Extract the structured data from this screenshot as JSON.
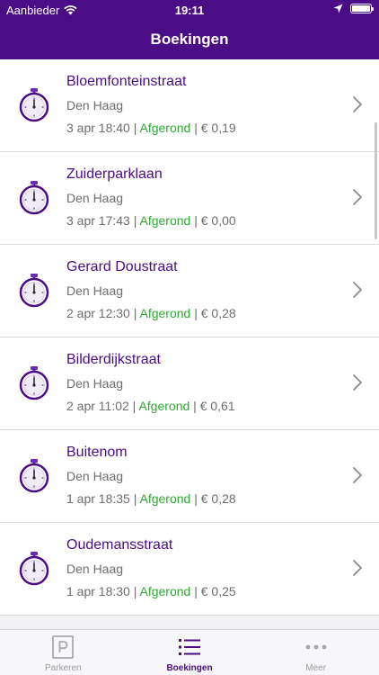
{
  "statusbar": {
    "carrier": "Aanbieder",
    "time": "19:11"
  },
  "navbar": {
    "title": "Boekingen"
  },
  "bookings": [
    {
      "street": "Bloemfonteinstraat",
      "city": "Den Haag",
      "datetime": "3 apr 18:40",
      "status": "Afgerond",
      "price": "€ 0,19"
    },
    {
      "street": "Zuiderparklaan",
      "city": "Den Haag",
      "datetime": "3 apr 17:43",
      "status": "Afgerond",
      "price": "€ 0,00"
    },
    {
      "street": "Gerard Doustraat",
      "city": "Den Haag",
      "datetime": "2 apr 12:30",
      "status": "Afgerond",
      "price": "€ 0,28"
    },
    {
      "street": "Bilderdijkstraat",
      "city": "Den Haag",
      "datetime": "2 apr 11:02",
      "status": "Afgerond",
      "price": "€ 0,61"
    },
    {
      "street": "Buitenom",
      "city": "Den Haag",
      "datetime": "1 apr 18:35",
      "status": "Afgerond",
      "price": "€ 0,28"
    },
    {
      "street": "Oudemansstraat",
      "city": "Den Haag",
      "datetime": "1 apr 18:30",
      "status": "Afgerond",
      "price": "€ 0,25"
    }
  ],
  "tabs": [
    {
      "label": "Parkeren",
      "icon": "parking-icon",
      "active": false
    },
    {
      "label": "Boekingen",
      "icon": "list-icon",
      "active": true
    },
    {
      "label": "Meer",
      "icon": "more-icon",
      "active": false
    }
  ],
  "colors": {
    "brand": "#4b0d85",
    "status_done": "#2ea832"
  }
}
